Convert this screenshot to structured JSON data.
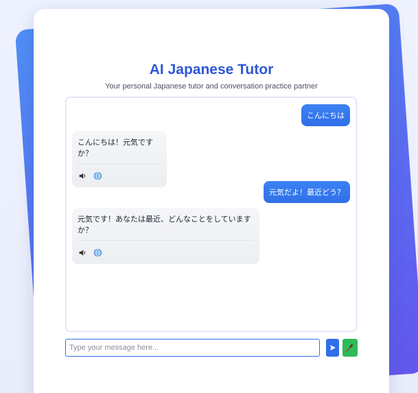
{
  "header": {
    "title": "AI Japanese Tutor",
    "subtitle": "Your personal Japanese tutor and conversation practice partner"
  },
  "messages": [
    {
      "role": "user",
      "text": "こんにちは"
    },
    {
      "role": "ai",
      "text": "こんにちは！元気ですか？",
      "icons": [
        "speaker-icon",
        "globe-icon"
      ]
    },
    {
      "role": "user",
      "text": "元気だよ！最近どう？"
    },
    {
      "role": "ai",
      "text": "元気です！あなたは最近、どんなことをしていますか？",
      "icons": [
        "speaker-icon",
        "globe-icon"
      ]
    }
  ],
  "composer": {
    "placeholder": "Type your message here...",
    "send_icon": "send-arrow-icon",
    "mic_icon": "microphone-icon"
  },
  "colors": {
    "accent": "#2f6fe8",
    "title": "#2f57d6",
    "mic": "#2dbb57"
  }
}
